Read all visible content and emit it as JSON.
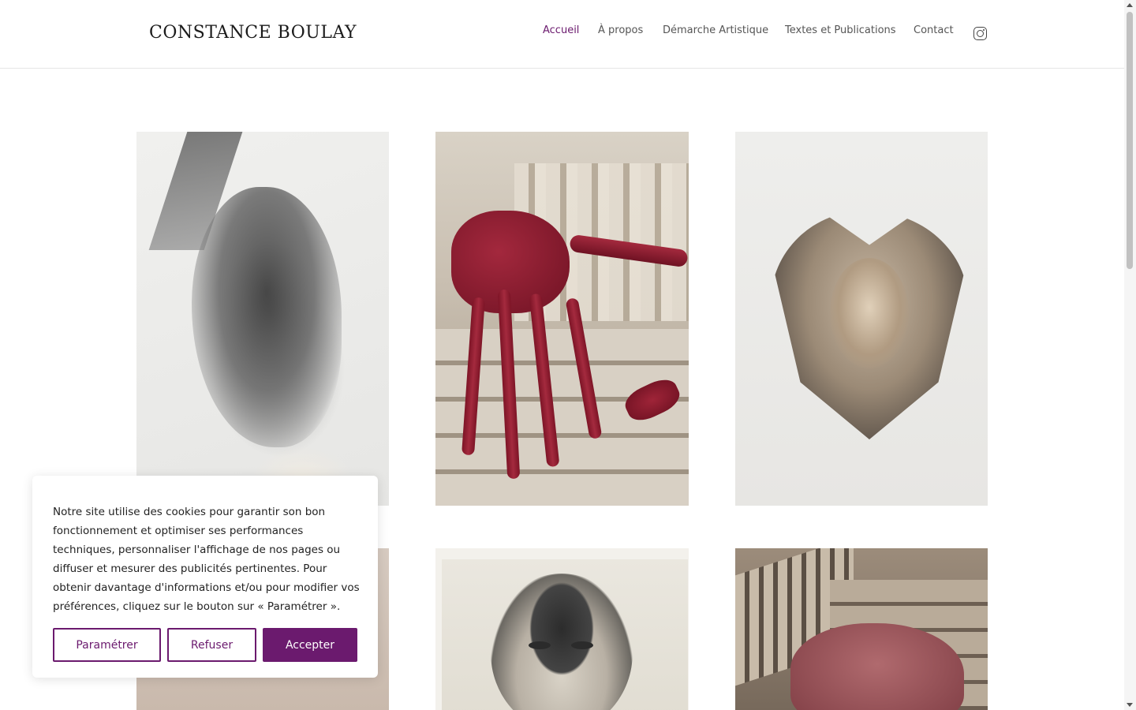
{
  "header": {
    "logo": "CONSTANCE BOULAY",
    "nav": [
      {
        "label": "Accueil",
        "active": true
      },
      {
        "label": "À propos",
        "active": false
      },
      {
        "label": "Démarche Artistique",
        "active": false
      },
      {
        "label": "Textes et Publications",
        "active": false
      },
      {
        "label": "Contact",
        "active": false
      }
    ],
    "social_icon": "instagram-icon"
  },
  "gallery": {
    "items": [
      {
        "name": "artwork-grey-veil"
      },
      {
        "name": "artwork-red-figure-stairs"
      },
      {
        "name": "artwork-petal-portrait"
      },
      {
        "name": "artwork-hand"
      },
      {
        "name": "artwork-man-portrait"
      },
      {
        "name": "artwork-figure-staircase"
      }
    ]
  },
  "cookie_banner": {
    "text": "Notre site utilise des cookies pour garantir son bon fonctionnement et optimiser ses performances techniques, personnaliser l'affichage de nos pages ou diffuser et mesurer des publicités pertinentes. Pour obtenir davantage d'informations et/ou pour modifier vos préférences, cliquez sur le bouton sur « Paramétrer ».",
    "buttons": {
      "settings": "Paramétrer",
      "refuse": "Refuser",
      "accept": "Accepter"
    }
  },
  "colors": {
    "accent": "#6b1a6e",
    "text": "#222222",
    "nav": "#555555"
  }
}
